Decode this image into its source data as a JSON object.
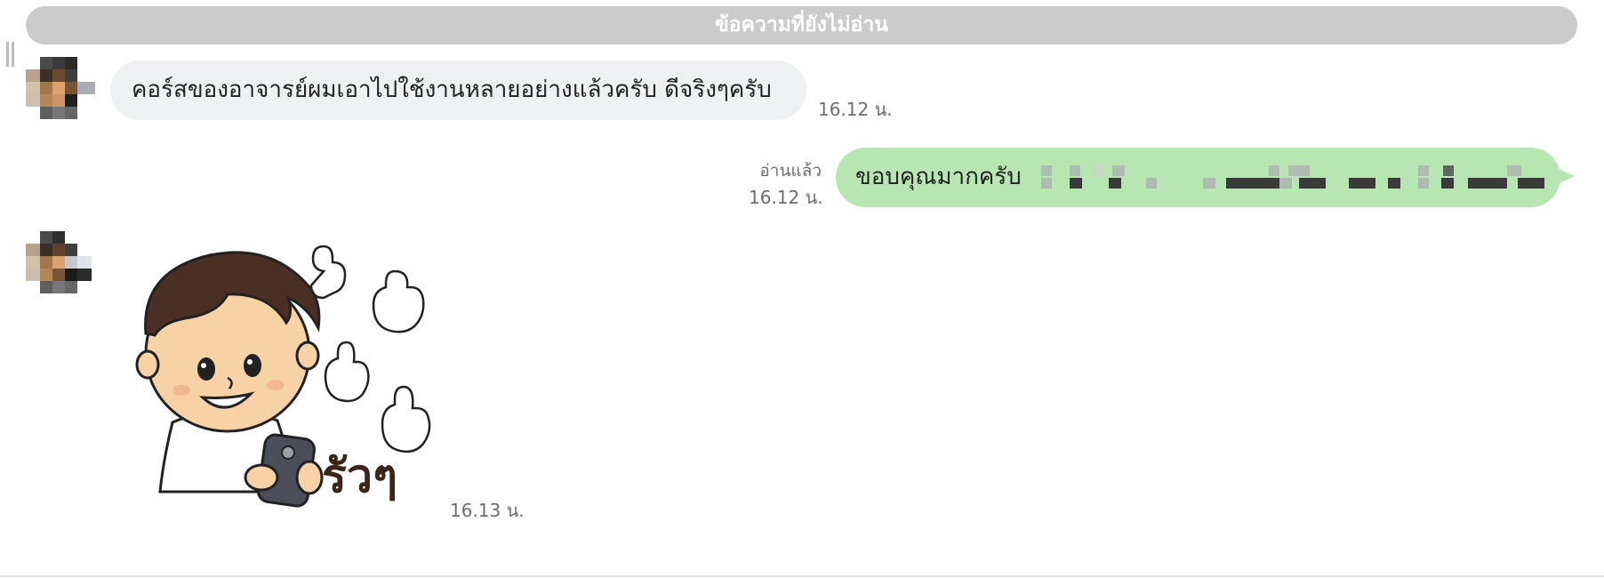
{
  "banner": {
    "unread_label": "ข้อความที่ยังไม่อ่าน"
  },
  "messages": [
    {
      "direction": "incoming",
      "text": "คอร์สของอาจารย์ผมเอาไปใช้งานหลายอย่างแล้วครับ ดีจริงๆครับ",
      "time": "16.12 น."
    },
    {
      "direction": "outgoing",
      "text": "ขอบคุณมากครับ",
      "read_status": "อ่านแล้ว",
      "time": "16.12 น.",
      "trailing_text_redacted": true
    },
    {
      "direction": "incoming",
      "type": "sticker",
      "sticker_caption": "รัวๆ",
      "time": "16.13 น."
    }
  ],
  "colors": {
    "banner_bg": "#cbcbcb",
    "incoming_bubble": "#eef0f2",
    "outgoing_bubble": "#b8e6b2",
    "timestamp": "#6e6e6e"
  },
  "icons": {
    "avatar": "pixelated-avatar",
    "sticker": "thumbs-up-boy-sticker"
  }
}
